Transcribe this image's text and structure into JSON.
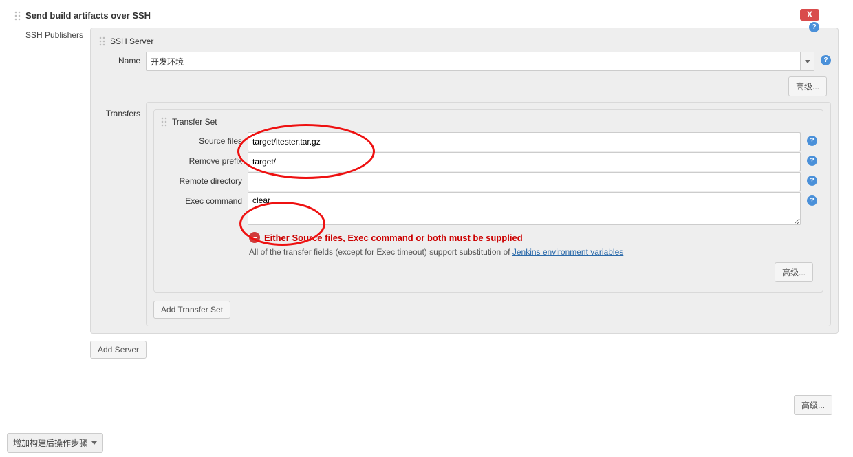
{
  "section_title": "Send build artifacts over SSH",
  "close_label": "X",
  "ssh_publishers_label": "SSH Publishers",
  "ssh_server_header": "SSH Server",
  "name_label": "Name",
  "server_name_value": "开发环境",
  "advanced_btn": "高级...",
  "transfers_label": "Transfers",
  "transfer_set_header": "Transfer Set",
  "fields": {
    "source_files_label": "Source files",
    "source_files_value": "target/itester.tar.gz",
    "remove_prefix_label": "Remove prefix",
    "remove_prefix_value": "target/",
    "remote_dir_label": "Remote directory",
    "remote_dir_value": "",
    "exec_cmd_label": "Exec command",
    "exec_cmd_value": "clear"
  },
  "error_msg": "Either Source files, Exec command or both must be supplied",
  "info_text_prefix": "All of the transfer fields (except for Exec timeout) support substitution of ",
  "info_link": "Jenkins environment variables",
  "add_transfer_btn": "Add Transfer Set",
  "add_server_btn": "Add Server",
  "post_build_btn": "增加构建后操作步骤"
}
